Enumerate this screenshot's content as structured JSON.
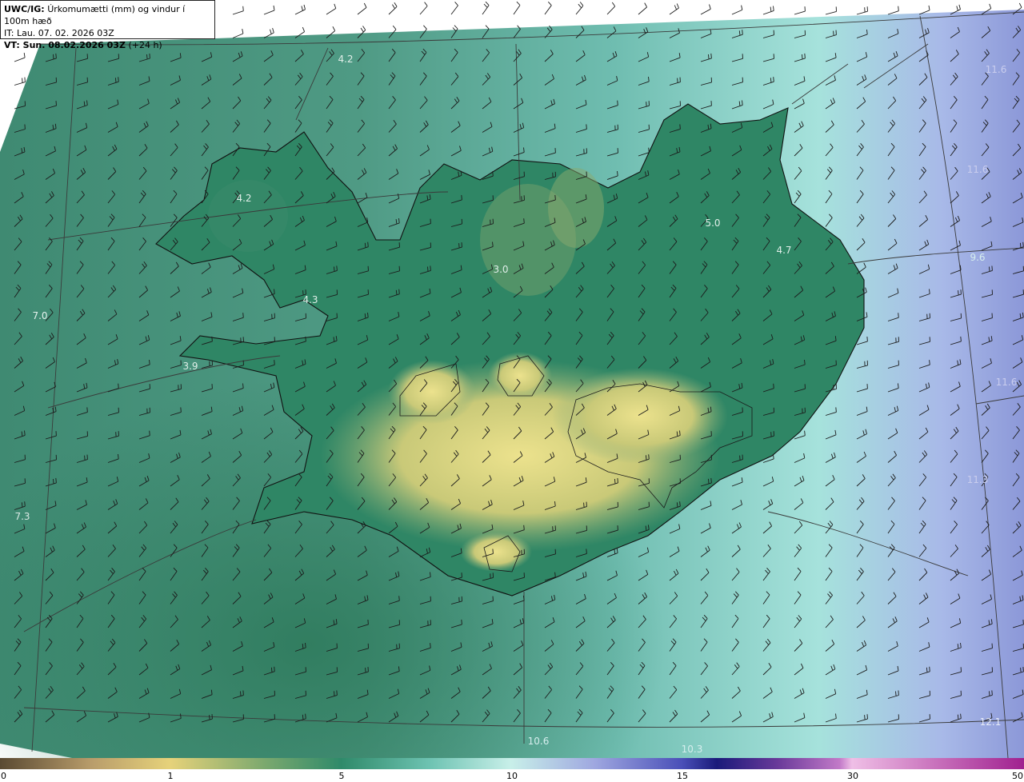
{
  "header": {
    "title": "UWC/IG:",
    "subtitle": "Úrkomumætti (mm) og vindur í 100m hæð",
    "issue_time": "IT: Lau. 07. 02. 2026 03Z",
    "valid_time": "VT: Sun. 08.02.2026 03Z",
    "lead": "(+24 h)"
  },
  "map_labels": [
    {
      "text": "4.2",
      "color": "#dfeee8"
    },
    {
      "text": "4.2",
      "color": "#dfeee8"
    },
    {
      "text": "4.3",
      "color": "#dfeee8"
    },
    {
      "text": "3.9",
      "color": "#dfeee8"
    },
    {
      "text": "3.0",
      "color": "#dfeee8"
    },
    {
      "text": "5.0",
      "color": "#dfeee8"
    },
    {
      "text": "4.7",
      "color": "#dfeee8"
    },
    {
      "text": "7.0",
      "color": "#e6f2ee"
    },
    {
      "text": "7.3",
      "color": "#d8e8e4"
    },
    {
      "text": "11.6",
      "color": "#c9cdee"
    },
    {
      "text": "11.6",
      "color": "#c9cdee"
    },
    {
      "text": "9.6",
      "color": "#d6eeee"
    },
    {
      "text": "11.6",
      "color": "#c9cdee"
    },
    {
      "text": "11.3",
      "color": "#c9cdee"
    },
    {
      "text": "12.1",
      "color": "#e8ecf8"
    },
    {
      "text": "10.6",
      "color": "#d6eeee"
    },
    {
      "text": "10.3",
      "color": "#d6eeee"
    }
  ],
  "colorbar": {
    "ticks": [
      "0",
      "1",
      "5",
      "10",
      "15",
      "30",
      "50"
    ]
  },
  "colors": {
    "land_dry": "#e7db85",
    "land_green": "#2c7f62",
    "sea_teal": "#5fa59a",
    "sea_light": "#a9e3dc",
    "sea_blue": "#8f9fdc",
    "coast": "#111111",
    "barb": "#1b1b1b"
  }
}
